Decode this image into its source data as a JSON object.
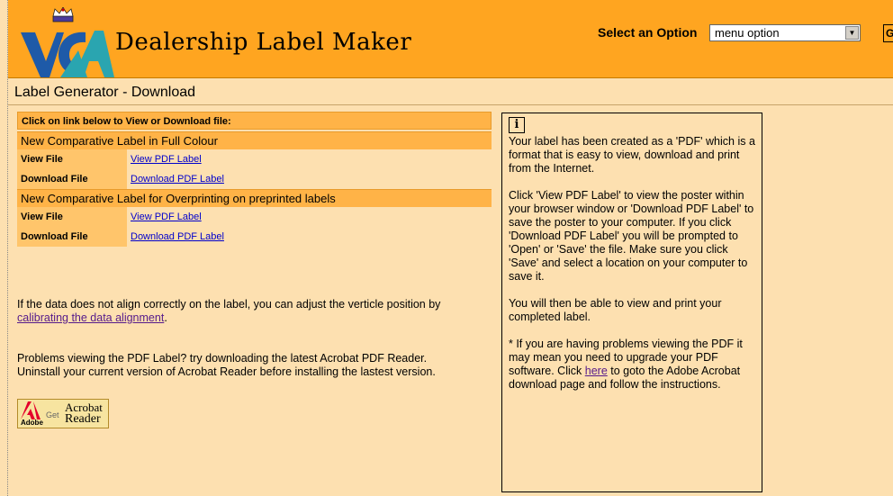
{
  "header": {
    "app_title": "Dealership Label Maker",
    "select_label": "Select an Option",
    "select_value": "menu option",
    "go_label": "GO"
  },
  "page": {
    "title": "Label Generator - Download"
  },
  "downloads": {
    "header": "Click on link below to View or Download file:",
    "sections": [
      {
        "title": "New Comparative Label in Full Colour",
        "view_label": "View File",
        "view_link": "View PDF Label",
        "download_label": "Download File",
        "download_link": "Download PDF Label"
      },
      {
        "title": "New Comparative Label for Overprinting on preprinted labels",
        "view_label": "View File",
        "view_link": "View PDF Label",
        "download_label": "Download File",
        "download_link": "Download PDF Label"
      }
    ]
  },
  "alignment": {
    "text": "If the data does not align correctly on the label, you can adjust the verticle position by ",
    "link": "calibrating the data alignment",
    "suffix": "."
  },
  "acrobat": {
    "text": "Problems viewing the PDF Label? try downloading the latest Acrobat PDF Reader. Uninstall your current version of Acrobat Reader before installing the lastest version.",
    "badge_adobe": "Adobe",
    "badge_get": "Get",
    "badge_acrobat": "Acrobat",
    "badge_reader": "Reader"
  },
  "info": {
    "icon": "i",
    "para1": "Your label has been created as a 'PDF' which is a format that is easy to view, download and print from the Internet.",
    "para2": "Click 'View PDF Label' to view the poster within your browser window or 'Download PDF Label' to save the poster to your computer. If you click 'Download PDF Label' you will be prompted to 'Open' or 'Save' the file. Make sure you click 'Save' and select a location on your computer to save it.",
    "para3": "You will then be able to view and print your completed label.",
    "para4_prefix": "* If you are having problems viewing the PDF it may mean you need to upgrade your PDF software. Click ",
    "para4_link": "here",
    "para4_suffix": " to goto the Adobe Acrobat download page and follow the instructions."
  },
  "icons": {
    "logo": "vca-crown-logo",
    "info": "info-icon",
    "adobe": "adobe-logo-icon"
  },
  "colors": {
    "header_bg": "#ffa520",
    "page_bg": "#fde0b0",
    "section_bg": "#ffb347",
    "label_bg": "#ffc56b",
    "link": "#0000cc",
    "visited_link": "#551a8b"
  }
}
